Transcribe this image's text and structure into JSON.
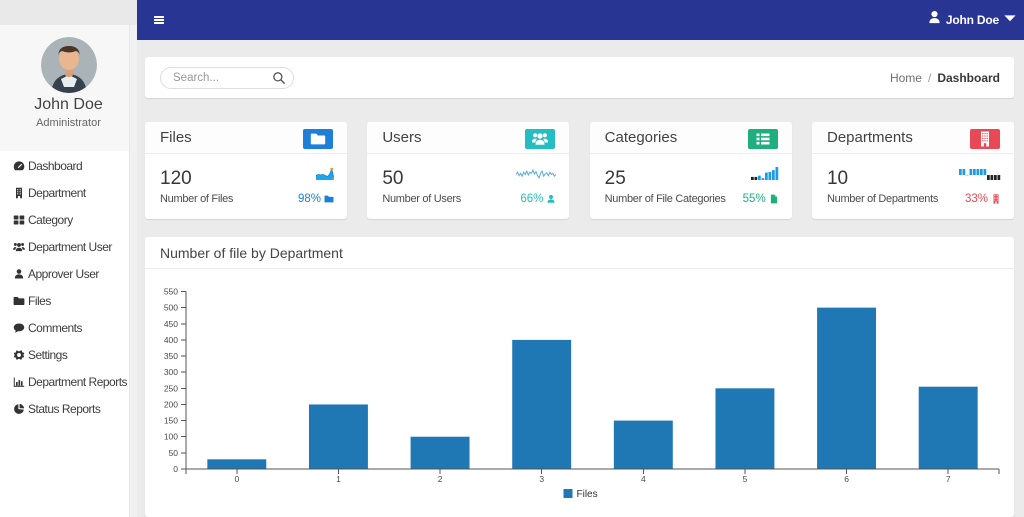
{
  "colors": {
    "navbar": "#283593",
    "bar": "#1f77b4",
    "blue": "#1e7fd8",
    "teal": "#23bdc2",
    "green": "#1fae7e",
    "red": "#e94855"
  },
  "navbar": {
    "user": "John Doe"
  },
  "sidebar": {
    "name": "John Doe",
    "role": "Administrator",
    "items": [
      {
        "icon": "tachometer",
        "label": "Dashboard"
      },
      {
        "icon": "building-sm",
        "label": "Department"
      },
      {
        "icon": "th-large",
        "label": "Category"
      },
      {
        "icon": "users-sm",
        "label": "Department User"
      },
      {
        "icon": "user-sm",
        "label": "Approver User"
      },
      {
        "icon": "folder-sm",
        "label": "Files"
      },
      {
        "icon": "comment",
        "label": "Comments"
      },
      {
        "icon": "gear",
        "label": "Settings"
      },
      {
        "icon": "bar-chart",
        "label": "Department Reports"
      },
      {
        "icon": "pie-chart",
        "label": "Status Reports"
      }
    ]
  },
  "search": {
    "placeholder": "Search..."
  },
  "breadcrumb": {
    "home": "Home",
    "sep": "/",
    "current": "Dashboard"
  },
  "stats": [
    {
      "title": "Files",
      "icon": "folder",
      "color": "#1e7fd8",
      "value": "120",
      "label": "Number of Files",
      "percent": "98%",
      "percent_icon": "folder",
      "spark": {
        "type": "area",
        "color": "#1ea6ec",
        "w": 18,
        "h": 12,
        "values": [
          1.8,
          2.4,
          2.1,
          2.4,
          1.9,
          1.3,
          2.3,
          5.2,
          0.3
        ]
      }
    },
    {
      "title": "Users",
      "icon": "users",
      "color": "#23bdc2",
      "value": "50",
      "label": "Number of Users",
      "percent": "66%",
      "percent_icon": "user",
      "spark": {
        "type": "line",
        "color": "#58abdf",
        "w": 40,
        "h": 11,
        "values": [
          4,
          6,
          3,
          5,
          2.5,
          6,
          4,
          7,
          3.5,
          6,
          5,
          8,
          4.5,
          6.5,
          3,
          1,
          5,
          7,
          2.5,
          4.5,
          5.5,
          3,
          6,
          4,
          5,
          2.5,
          4
        ]
      }
    },
    {
      "title": "Categories",
      "icon": "list",
      "color": "#1fae7e",
      "value": "25",
      "label": "Number of File Categories",
      "percent": "55%",
      "percent_icon": "file",
      "spark": {
        "type": "bars",
        "baseline": "bottom",
        "color": "#1e9be8",
        "w": 28,
        "h": 13,
        "values": [
          2.5,
          2.5,
          3.5,
          1.5,
          6,
          6.5,
          8,
          10.5
        ],
        "colors": [
          "#222222",
          "#222222",
          "#1e9be8",
          "#1e9be8",
          "#1e9be8",
          "#1e9be8",
          "#1e9be8",
          "#1e9be8"
        ]
      }
    },
    {
      "title": "Departments",
      "icon": "building",
      "color": "#e94855",
      "value": "10",
      "label": "Number of Departments",
      "percent": "33%",
      "percent_icon": "building",
      "spark": {
        "type": "bars",
        "baseline": "mid",
        "color": "#1e9be8",
        "w": 42,
        "h": 11,
        "values": [
          1,
          1,
          0,
          1,
          1,
          1,
          1,
          1,
          -1,
          -1,
          -1,
          -1
        ]
      }
    }
  ],
  "chart_data": {
    "type": "bar",
    "title": "Number of file by Department",
    "categories": [
      "0",
      "1",
      "2",
      "3",
      "4",
      "5",
      "6",
      "7"
    ],
    "series": [
      {
        "name": "Files",
        "values": [
          30,
          200,
          100,
          400,
          150,
          250,
          500,
          255
        ]
      }
    ],
    "ylim": [
      0,
      550
    ],
    "ytick_step": 50,
    "grid": false,
    "legend_position": "bottom",
    "xlabel": "",
    "ylabel": ""
  }
}
